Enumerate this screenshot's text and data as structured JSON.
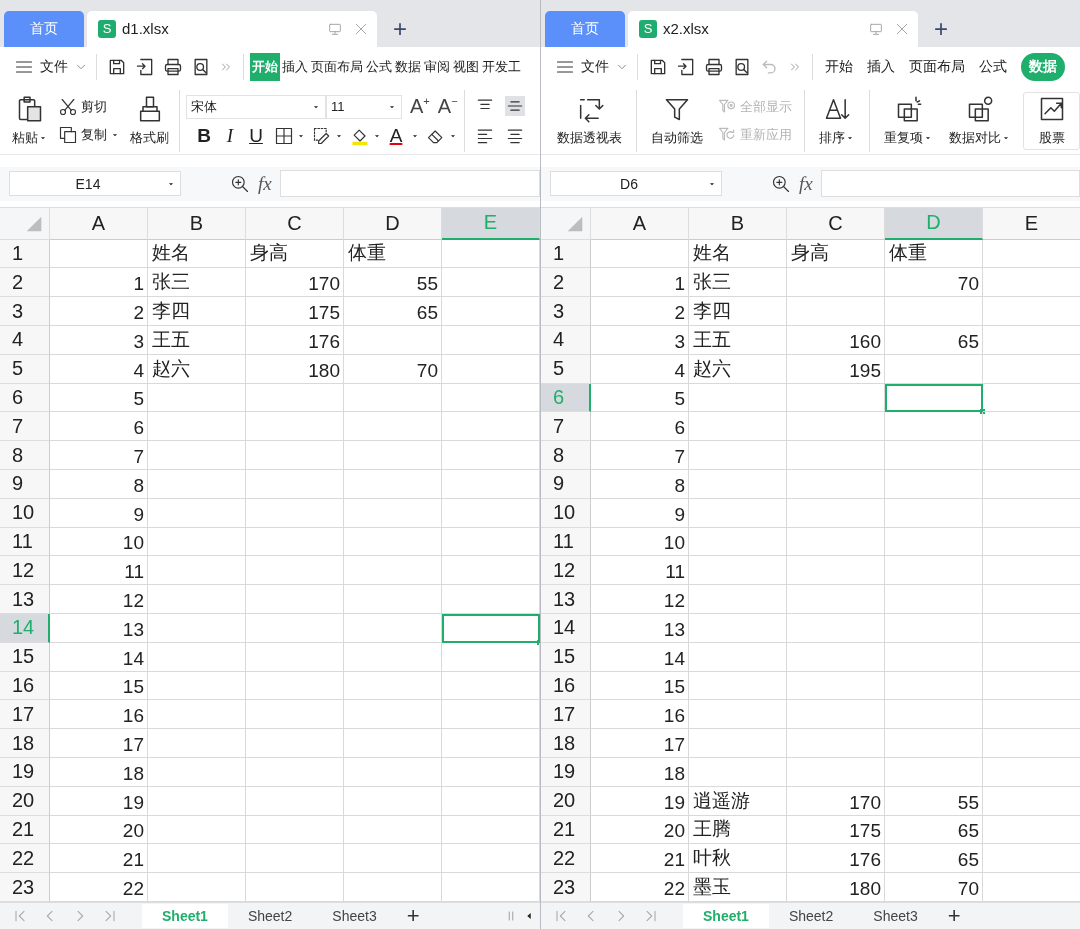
{
  "windows": [
    {
      "home_tab": "首页",
      "file_tab": {
        "badge": "S",
        "name": "d1.xlsx"
      },
      "new_tab": "+",
      "menu": "文件",
      "show_undo": false,
      "ribbon_tabs": [
        {
          "label": "开始",
          "selected": true
        },
        {
          "label": "插入",
          "selected": false
        },
        {
          "label": "页面布局",
          "selected": false
        },
        {
          "label": "公式",
          "selected": false
        },
        {
          "label": "数据",
          "selected": false
        },
        {
          "label": "审阅",
          "selected": false
        },
        {
          "label": "视图",
          "selected": false
        },
        {
          "label": "开发工",
          "selected": false
        }
      ],
      "ribbon": {
        "kind": "home",
        "paste": "粘贴",
        "cut": "剪切",
        "copy": "复制",
        "format_painter": "格式刷",
        "font": "宋体",
        "font_size": "11",
        "grow": {
          "letter": "A",
          "sign": "+"
        },
        "shrink": {
          "letter": "A",
          "sign": "−"
        },
        "bold": "B",
        "italic": "I",
        "underline": "U",
        "font_color": "A"
      },
      "name_box": "E14",
      "formula_label": "fx",
      "columns": [
        {
          "label": "A",
          "selected": false
        },
        {
          "label": "B",
          "selected": false
        },
        {
          "label": "C",
          "selected": false
        },
        {
          "label": "D",
          "selected": false
        },
        {
          "label": "E",
          "selected": true
        }
      ],
      "rows": [
        {
          "label": "1",
          "selected": false,
          "cells": {
            "b": "姓名",
            "c": "身高",
            "d": "体重"
          }
        },
        {
          "label": "2",
          "selected": false,
          "cells": {
            "a": "1",
            "b": "张三",
            "c": "170",
            "d": "55"
          }
        },
        {
          "label": "3",
          "selected": false,
          "cells": {
            "a": "2",
            "b": "李四",
            "c": "175",
            "d": "65"
          }
        },
        {
          "label": "4",
          "selected": false,
          "cells": {
            "a": "3",
            "b": "王五",
            "c": "176"
          }
        },
        {
          "label": "5",
          "selected": false,
          "cells": {
            "a": "4",
            "b": "赵六",
            "c": "180",
            "d": "70"
          }
        },
        {
          "label": "6",
          "selected": false,
          "cells": {
            "a": "5"
          }
        },
        {
          "label": "7",
          "selected": false,
          "cells": {
            "a": "6"
          }
        },
        {
          "label": "8",
          "selected": false,
          "cells": {
            "a": "7"
          }
        },
        {
          "label": "9",
          "selected": false,
          "cells": {
            "a": "8"
          }
        },
        {
          "label": "10",
          "selected": false,
          "cells": {
            "a": "9"
          }
        },
        {
          "label": "11",
          "selected": false,
          "cells": {
            "a": "10"
          }
        },
        {
          "label": "12",
          "selected": false,
          "cells": {
            "a": "11"
          }
        },
        {
          "label": "13",
          "selected": false,
          "cells": {
            "a": "12"
          }
        },
        {
          "label": "14",
          "selected": true,
          "cells": {
            "a": "13"
          }
        },
        {
          "label": "15",
          "selected": false,
          "cells": {
            "a": "14"
          }
        },
        {
          "label": "16",
          "selected": false,
          "cells": {
            "a": "15"
          }
        },
        {
          "label": "17",
          "selected": false,
          "cells": {
            "a": "16"
          }
        },
        {
          "label": "18",
          "selected": false,
          "cells": {
            "a": "17"
          }
        },
        {
          "label": "19",
          "selected": false,
          "cells": {
            "a": "18"
          }
        },
        {
          "label": "20",
          "selected": false,
          "cells": {
            "a": "19"
          }
        },
        {
          "label": "21",
          "selected": false,
          "cells": {
            "a": "20"
          }
        },
        {
          "label": "22",
          "selected": false,
          "cells": {
            "a": "21"
          }
        },
        {
          "label": "23",
          "selected": false,
          "cells": {
            "a": "22"
          }
        }
      ],
      "sheets": [
        {
          "label": "Sheet1",
          "selected": true
        },
        {
          "label": "Sheet2",
          "selected": false
        },
        {
          "label": "Sheet3",
          "selected": false
        }
      ],
      "add_sheet": "+",
      "split_controls": true
    },
    {
      "home_tab": "首页",
      "file_tab": {
        "badge": "S",
        "name": "x2.xlsx"
      },
      "new_tab": "+",
      "menu": "文件",
      "show_undo": true,
      "ribbon_tabs": [
        {
          "label": "开始",
          "selected": false
        },
        {
          "label": "插入",
          "selected": false
        },
        {
          "label": "页面布局",
          "selected": false
        },
        {
          "label": "公式",
          "selected": false
        },
        {
          "label": "数据",
          "selected": true
        }
      ],
      "ribbon": {
        "kind": "data",
        "items": [
          {
            "kind": "big",
            "label": "数据透视表",
            "dropdown": false
          },
          {
            "kind": "big",
            "label": "自动筛选",
            "dropdown": false
          },
          {
            "kind": "stack",
            "entries": [
              {
                "label": "全部显示",
                "disabled": true
              },
              {
                "label": "重新应用",
                "disabled": true
              }
            ]
          },
          {
            "kind": "big",
            "label": "排序",
            "dropdown": true
          },
          {
            "kind": "big",
            "label": "重复项",
            "dropdown": true
          },
          {
            "kind": "big",
            "label": "数据对比",
            "dropdown": true
          },
          {
            "kind": "boxed",
            "label": "股票",
            "dropdown": false
          }
        ]
      },
      "name_box": "D6",
      "formula_label": "fx",
      "columns": [
        {
          "label": "A",
          "selected": false
        },
        {
          "label": "B",
          "selected": false
        },
        {
          "label": "C",
          "selected": false
        },
        {
          "label": "D",
          "selected": true
        },
        {
          "label": "E",
          "selected": false
        }
      ],
      "rows": [
        {
          "label": "1",
          "selected": false,
          "cells": {
            "b": "姓名",
            "c": "身高",
            "d": "体重"
          }
        },
        {
          "label": "2",
          "selected": false,
          "cells": {
            "a": "1",
            "b": "张三",
            "d": "70"
          }
        },
        {
          "label": "3",
          "selected": false,
          "cells": {
            "a": "2",
            "b": "李四"
          }
        },
        {
          "label": "4",
          "selected": false,
          "cells": {
            "a": "3",
            "b": "王五",
            "c": "160",
            "d": "65"
          }
        },
        {
          "label": "5",
          "selected": false,
          "cells": {
            "a": "4",
            "b": "赵六",
            "c": "195"
          }
        },
        {
          "label": "6",
          "selected": true,
          "cells": {
            "a": "5"
          }
        },
        {
          "label": "7",
          "selected": false,
          "cells": {
            "a": "6"
          }
        },
        {
          "label": "8",
          "selected": false,
          "cells": {
            "a": "7"
          }
        },
        {
          "label": "9",
          "selected": false,
          "cells": {
            "a": "8"
          }
        },
        {
          "label": "10",
          "selected": false,
          "cells": {
            "a": "9"
          }
        },
        {
          "label": "11",
          "selected": false,
          "cells": {
            "a": "10"
          }
        },
        {
          "label": "12",
          "selected": false,
          "cells": {
            "a": "11"
          }
        },
        {
          "label": "13",
          "selected": false,
          "cells": {
            "a": "12"
          }
        },
        {
          "label": "14",
          "selected": false,
          "cells": {
            "a": "13"
          }
        },
        {
          "label": "15",
          "selected": false,
          "cells": {
            "a": "14"
          }
        },
        {
          "label": "16",
          "selected": false,
          "cells": {
            "a": "15"
          }
        },
        {
          "label": "17",
          "selected": false,
          "cells": {
            "a": "16"
          }
        },
        {
          "label": "18",
          "selected": false,
          "cells": {
            "a": "17"
          }
        },
        {
          "label": "19",
          "selected": false,
          "cells": {
            "a": "18"
          }
        },
        {
          "label": "20",
          "selected": false,
          "cells": {
            "a": "19",
            "b": "逍遥游",
            "c": "170",
            "d": "55"
          }
        },
        {
          "label": "21",
          "selected": false,
          "cells": {
            "a": "20",
            "b": "王腾",
            "c": "175",
            "d": "65"
          }
        },
        {
          "label": "22",
          "selected": false,
          "cells": {
            "a": "21",
            "b": "叶秋",
            "c": "176",
            "d": "65"
          }
        },
        {
          "label": "23",
          "selected": false,
          "cells": {
            "a": "22",
            "b": "墨玉",
            "c": "180",
            "d": "70"
          }
        }
      ],
      "sheets": [
        {
          "label": "Sheet1",
          "selected": true
        },
        {
          "label": "Sheet2",
          "selected": false
        },
        {
          "label": "Sheet3",
          "selected": false
        }
      ],
      "add_sheet": "+",
      "split_controls": false
    }
  ]
}
